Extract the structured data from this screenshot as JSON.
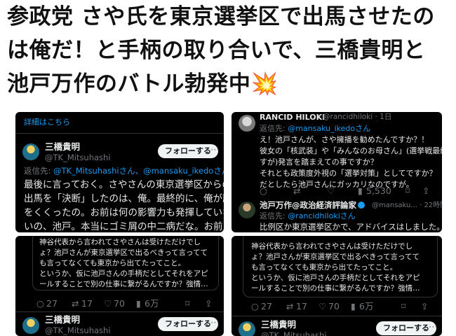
{
  "headline": {
    "line1": "参政党 さや氏を東京選挙区で出馬させたの",
    "line2": "は俺だ！と手柄の取り合いで、三橋貴明と",
    "line3": "池戸万作のバトル勃発中",
    "emoji": "💥"
  },
  "panel_top_left": {
    "details_link": "詳細はこちら",
    "name": "三橋貴明",
    "handle": "@TK_Mitsuhashi",
    "follow_label": "フォローする",
    "reply_prefix": "返信先: ",
    "reply_targets": "@TK_Mitsuhashiさん、@mansaku_ikedoさん",
    "body": [
      "最後に言っておく。さやさんの東京選挙区からの",
      "出馬を「決断」したのは、俺。最終的に、俺が腹",
      "をくくったの。お前は何の影響力も発揮していな",
      "いの、池戸。本当にゴミ屑の中二病だな。お前は"
    ]
  },
  "panel_top_right": {
    "name": "RANCID HILOKI",
    "handle": "@rancidhiloki · 1日",
    "reply_prefix": "返信先: ",
    "reply_target": "@mansaku_ikedoさん",
    "body": [
      "え！池戸さんが、さや擁播を勧めたんですか？！",
      "彼女の「核武装」や「みんなのお母さん」(選挙戦最終日で",
      "すが)発言を踏まえての事ですか？",
      "それとも政策度外視の「選挙対策」としてですか？",
      "だとしたら池戸さんにガッカリなのですが。"
    ],
    "metrics": {
      "views": "5,530"
    },
    "reply": {
      "name": "池戸万作@政治経済評論家",
      "handle": "@mansaku... · 22時間",
      "reply_prefix": "返信先: ",
      "reply_target": "@rancidhilokiさん",
      "body": "比例区か東京選挙区かで、アドバイスはしました。"
    }
  },
  "panel_bottom_left": {
    "quote_lines": [
      "神谷代表から言われてさやさんは受けただけでし",
      "ょ？池戸さんが東京選挙区で出るべきって言ってて",
      "も言ってなくても東京から出てたってこと。",
      "というか、仮に池戸さんの手柄だとしてそれをアピ",
      "ールすることで別の仕事に繋がるんですか？強情…"
    ],
    "metrics": {
      "replies": "27",
      "reposts": "17",
      "likes": "70",
      "views": "6万"
    },
    "next_name": "三橋貴明",
    "next_handle": "@TK_Mitsuhashi",
    "follow_label": "フォローする"
  },
  "panel_bottom_right": {
    "quote_lines": [
      "神谷代表から言われてさやさんは受けただけでし",
      "ょ？池戸さんが東京選挙区で出るべきって言ってて",
      "も言ってなくても東京から出てたってこと。",
      "というか、仮に池戸さんの手柄だとしてそれをアピ",
      "ールすることで別の仕事に繋がるんですか？強情…"
    ],
    "metrics": {
      "replies": "27",
      "reposts": "17",
      "likes": "70",
      "views": "6万"
    },
    "next_name": "三橋貴明",
    "next_handle": "@TK_Mitsuhashi",
    "follow_label": "フォローする"
  },
  "icons": {
    "reply": "speech-bubble-icon",
    "repost": "repost-arrows-icon",
    "like": "heart-icon",
    "views": "bar-chart-icon",
    "bookmark": "bookmark-icon",
    "share": "share-icon",
    "more": "more-dots-icon"
  },
  "colors": {
    "link": "#1d9bf0",
    "panel_bg": "#000000",
    "muted": "#71767b",
    "text": "#e7e9ea"
  }
}
